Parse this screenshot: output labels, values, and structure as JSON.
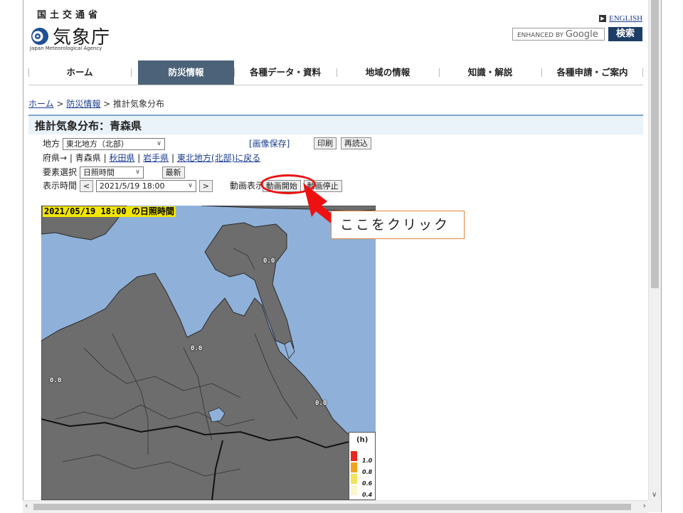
{
  "header": {
    "ministry": "国土交通省",
    "logo_text": "気象庁",
    "logo_sub": "Japan Meteorological Agency",
    "english_link": "ENGLISH",
    "search_placeholder_prefix": "ENHANCED BY",
    "search_placeholder_brand": "Google",
    "search_button": "検索"
  },
  "nav": {
    "items": [
      {
        "label": "ホーム"
      },
      {
        "label": "防災情報"
      },
      {
        "label": "各種データ・資料"
      },
      {
        "label": "地域の情報"
      },
      {
        "label": "知識・解説"
      },
      {
        "label": "各種申請・ご案内"
      }
    ],
    "active_index": 1
  },
  "breadcrumb": {
    "home": "ホーム",
    "sep1": " > ",
    "disaster": "防災情報",
    "sep2": " > ",
    "current": "推計気象分布"
  },
  "page": {
    "title": "推計気象分布：青森県"
  },
  "controls": {
    "region_label": "地方",
    "region_value": "東北地方（北部）",
    "save_image": "[画像保存]",
    "print_button": "印刷",
    "reload_button": "再読込",
    "pref_label": "府県→",
    "pref_current": "青森県",
    "pref_akita": "秋田県",
    "pref_iwate": "岩手県",
    "back_region": "東北地方(北部)に戻る",
    "element_label": "要素選択",
    "element_value": "日照時間",
    "latest_button": "最新",
    "time_label": "表示時間",
    "prev_button": "<",
    "time_value": "2021/5/19 18:00",
    "next_button": ">",
    "animation_label": "動画表示",
    "anim_start_button": "動画開始",
    "anim_stop_button": "動画停止"
  },
  "annotation": {
    "callout_text": "ここをクリック",
    "ellipse_color": "#ee1111",
    "arrow_color": "#ee1111"
  },
  "map": {
    "stamp": "2021/05/19 18:00 の日照時間",
    "labels": [
      "0.0",
      "0.0",
      "0.0",
      "0.0"
    ],
    "sea_color": "#8fb1d9",
    "land_color": "#6d6d6d"
  },
  "legend": {
    "unit": "(h)",
    "entries": [
      {
        "label": "1.0",
        "color": "#e8281e"
      },
      {
        "label": "0.8",
        "color": "#f2a31f"
      },
      {
        "label": "0.6",
        "color": "#f5e35a"
      },
      {
        "label": "0.4",
        "color": "#fbf7c9"
      }
    ]
  }
}
